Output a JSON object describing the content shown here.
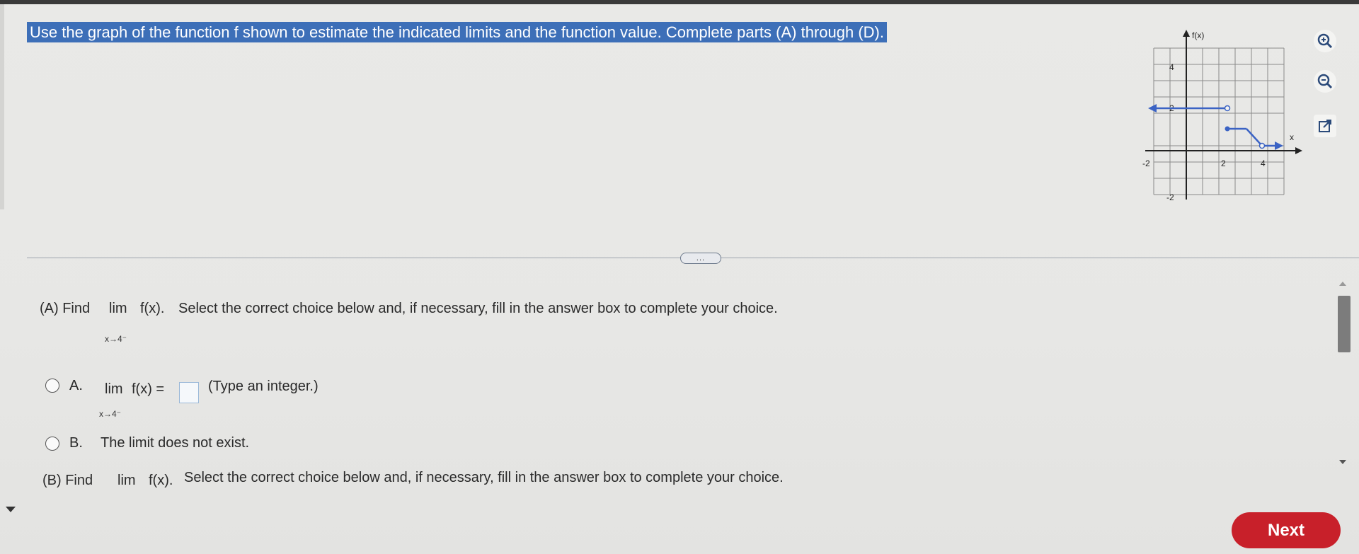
{
  "instructions": "Use the graph of the function f shown to estimate the indicated limits and the function value. Complete parts (A) through (D).",
  "graph": {
    "y_label": "f(x)",
    "x_label": "x",
    "ticks": {
      "y_top": "4",
      "y_mid": "2",
      "y_bottom": "-2",
      "x_left": "-2",
      "x_mid": "2",
      "x_right": "4"
    }
  },
  "tools": {
    "zoom_in": "zoom-in-icon",
    "zoom_out": "zoom-out-icon",
    "popout": "popout-icon"
  },
  "more_button": "...",
  "partA": {
    "prefix": "(A) Find",
    "lim": "lim",
    "func": "f(x).",
    "rest": "Select the correct choice below and, if necessary, fill in the answer box to complete your choice.",
    "sub": "x→4⁻"
  },
  "choiceA": {
    "letter": "A.",
    "lim": "lim",
    "expr": "f(x) =",
    "sub": "x→4⁻",
    "hint": "(Type an integer.)"
  },
  "choiceB": {
    "letter": "B.",
    "text": "The limit does not exist."
  },
  "partB": {
    "prefix": "(B) Find",
    "lim": "lim",
    "func": "f(x).",
    "rest": "Select the correct choice below and, if necessary, fill in the answer box to complete your choice."
  },
  "next_label": "Next",
  "colors": {
    "accent": "#c8202a",
    "highlight": "#3d6fb8",
    "curve": "#3b63c4"
  }
}
